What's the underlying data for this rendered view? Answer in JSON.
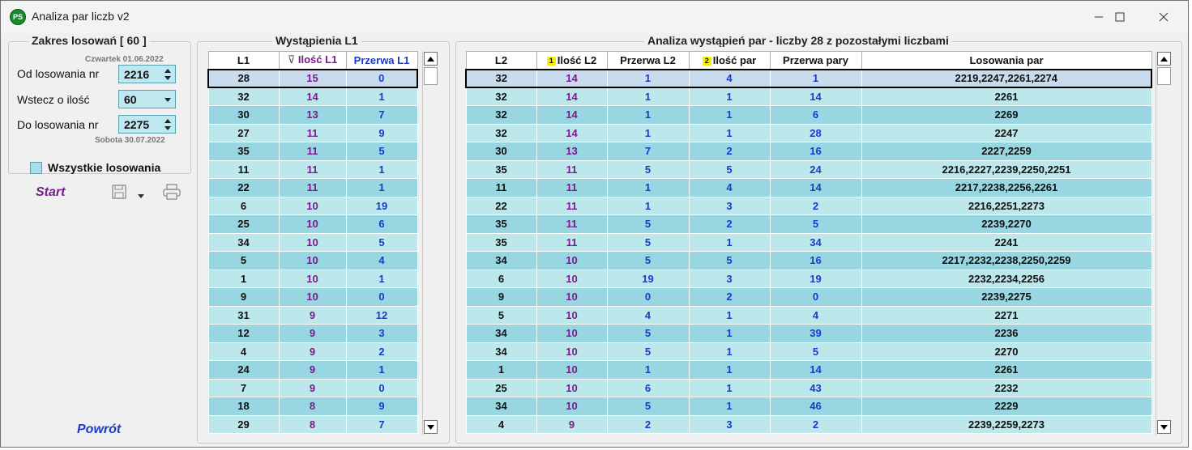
{
  "window": {
    "title": "Analiza par liczb v2",
    "icon_text": "PS"
  },
  "range": {
    "title": "Zakres losowań  [ 60 ]",
    "from_date": "Czwartek 01.06.2022",
    "to_date": "Sobota 30.07.2022",
    "from_label": "Od losowania nr",
    "from_value": "2216",
    "back_label": "Wstecz o ilość",
    "back_value": "60",
    "to_label": "Do losowania nr",
    "to_value": "2275",
    "all_label": "Wszystkie losowania"
  },
  "actions": {
    "start": "Start",
    "back": "Powrót"
  },
  "left_table": {
    "title": "Wystąpienia L1",
    "headers": [
      "L1",
      "Ilość L1",
      "Przerwa L1"
    ],
    "sort_marker": "⊽",
    "rows": [
      [
        "28",
        "15",
        "0"
      ],
      [
        "32",
        "14",
        "1"
      ],
      [
        "30",
        "13",
        "7"
      ],
      [
        "27",
        "11",
        "9"
      ],
      [
        "35",
        "11",
        "5"
      ],
      [
        "11",
        "11",
        "1"
      ],
      [
        "22",
        "11",
        "1"
      ],
      [
        "6",
        "10",
        "19"
      ],
      [
        "25",
        "10",
        "6"
      ],
      [
        "34",
        "10",
        "5"
      ],
      [
        "5",
        "10",
        "4"
      ],
      [
        "1",
        "10",
        "1"
      ],
      [
        "9",
        "10",
        "0"
      ],
      [
        "31",
        "9",
        "12"
      ],
      [
        "12",
        "9",
        "3"
      ],
      [
        "4",
        "9",
        "2"
      ],
      [
        "24",
        "9",
        "1"
      ],
      [
        "7",
        "9",
        "0"
      ],
      [
        "18",
        "8",
        "9"
      ],
      [
        "29",
        "8",
        "7"
      ]
    ]
  },
  "right_table": {
    "title": "Analiza wystąpień par - liczby 28 z pozostałymi liczbami",
    "headers": [
      "L2",
      "Ilość L2",
      "Przerwa L2",
      "Ilość par",
      "Przerwa pary",
      "Losowania par"
    ],
    "badge1": "1",
    "badge2": "2",
    "rows": [
      [
        "32",
        "14",
        "1",
        "4",
        "1",
        "2219,2247,2261,2274"
      ],
      [
        "32",
        "14",
        "1",
        "1",
        "14",
        "2261"
      ],
      [
        "32",
        "14",
        "1",
        "1",
        "6",
        "2269"
      ],
      [
        "32",
        "14",
        "1",
        "1",
        "28",
        "2247"
      ],
      [
        "30",
        "13",
        "7",
        "2",
        "16",
        "2227,2259"
      ],
      [
        "35",
        "11",
        "5",
        "5",
        "24",
        "2216,2227,2239,2250,2251"
      ],
      [
        "11",
        "11",
        "1",
        "4",
        "14",
        "2217,2238,2256,2261"
      ],
      [
        "22",
        "11",
        "1",
        "3",
        "2",
        "2216,2251,2273"
      ],
      [
        "35",
        "11",
        "5",
        "2",
        "5",
        "2239,2270"
      ],
      [
        "35",
        "11",
        "5",
        "1",
        "34",
        "2241"
      ],
      [
        "34",
        "10",
        "5",
        "5",
        "16",
        "2217,2232,2238,2250,2259"
      ],
      [
        "6",
        "10",
        "19",
        "3",
        "19",
        "2232,2234,2256"
      ],
      [
        "9",
        "10",
        "0",
        "2",
        "0",
        "2239,2275"
      ],
      [
        "5",
        "10",
        "4",
        "1",
        "4",
        "2271"
      ],
      [
        "34",
        "10",
        "5",
        "1",
        "39",
        "2236"
      ],
      [
        "34",
        "10",
        "5",
        "1",
        "5",
        "2270"
      ],
      [
        "1",
        "10",
        "1",
        "1",
        "14",
        "2261"
      ],
      [
        "25",
        "10",
        "6",
        "1",
        "43",
        "2232"
      ],
      [
        "34",
        "10",
        "5",
        "1",
        "46",
        "2229"
      ],
      [
        "4",
        "9",
        "2",
        "3",
        "2",
        "2239,2259,2273"
      ]
    ]
  }
}
